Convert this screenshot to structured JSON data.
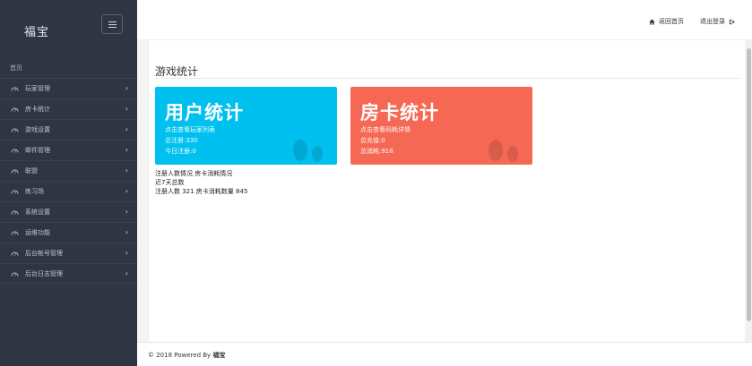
{
  "sidebar": {
    "brand": "福宝",
    "section_label": "首页",
    "items": [
      {
        "label": "玩家管理",
        "icon": "dashboard-icon"
      },
      {
        "label": "房卡统计",
        "icon": "dashboard-icon"
      },
      {
        "label": "游戏设置",
        "icon": "dashboard-icon"
      },
      {
        "label": "邮件管理",
        "icon": "dashboard-icon"
      },
      {
        "label": "联盟",
        "icon": "dashboard-icon"
      },
      {
        "label": "练习场",
        "icon": "dashboard-icon"
      },
      {
        "label": "系统设置",
        "icon": "dashboard-icon"
      },
      {
        "label": "运维功能",
        "icon": "dashboard-icon"
      },
      {
        "label": "后台帐号管理",
        "icon": "dashboard-icon"
      },
      {
        "label": "后台日志管理",
        "icon": "dashboard-icon"
      }
    ]
  },
  "topbar": {
    "home_label": "返回首页",
    "logout_label": "退出登录"
  },
  "main": {
    "title": "游戏统计",
    "cards": {
      "users": {
        "title": "用户统计",
        "line1": "点击查看玩家列表",
        "line2": "总注册:330",
        "line3": "今日注册:0",
        "color": "#00c0ef"
      },
      "rooms": {
        "title": "房卡统计",
        "line1": "点击查看码耗详情",
        "line2": "总充值:0",
        "line3": "总消耗:918",
        "color": "#f56954"
      }
    },
    "summary": {
      "line1": "注册人数情况 房卡消耗情况",
      "line2": "近7天总数",
      "line3": "注册人数 321 房卡消耗数量 845"
    }
  },
  "footer": {
    "prefix": "© 2018 Powered By",
    "brand": "福宝"
  }
}
